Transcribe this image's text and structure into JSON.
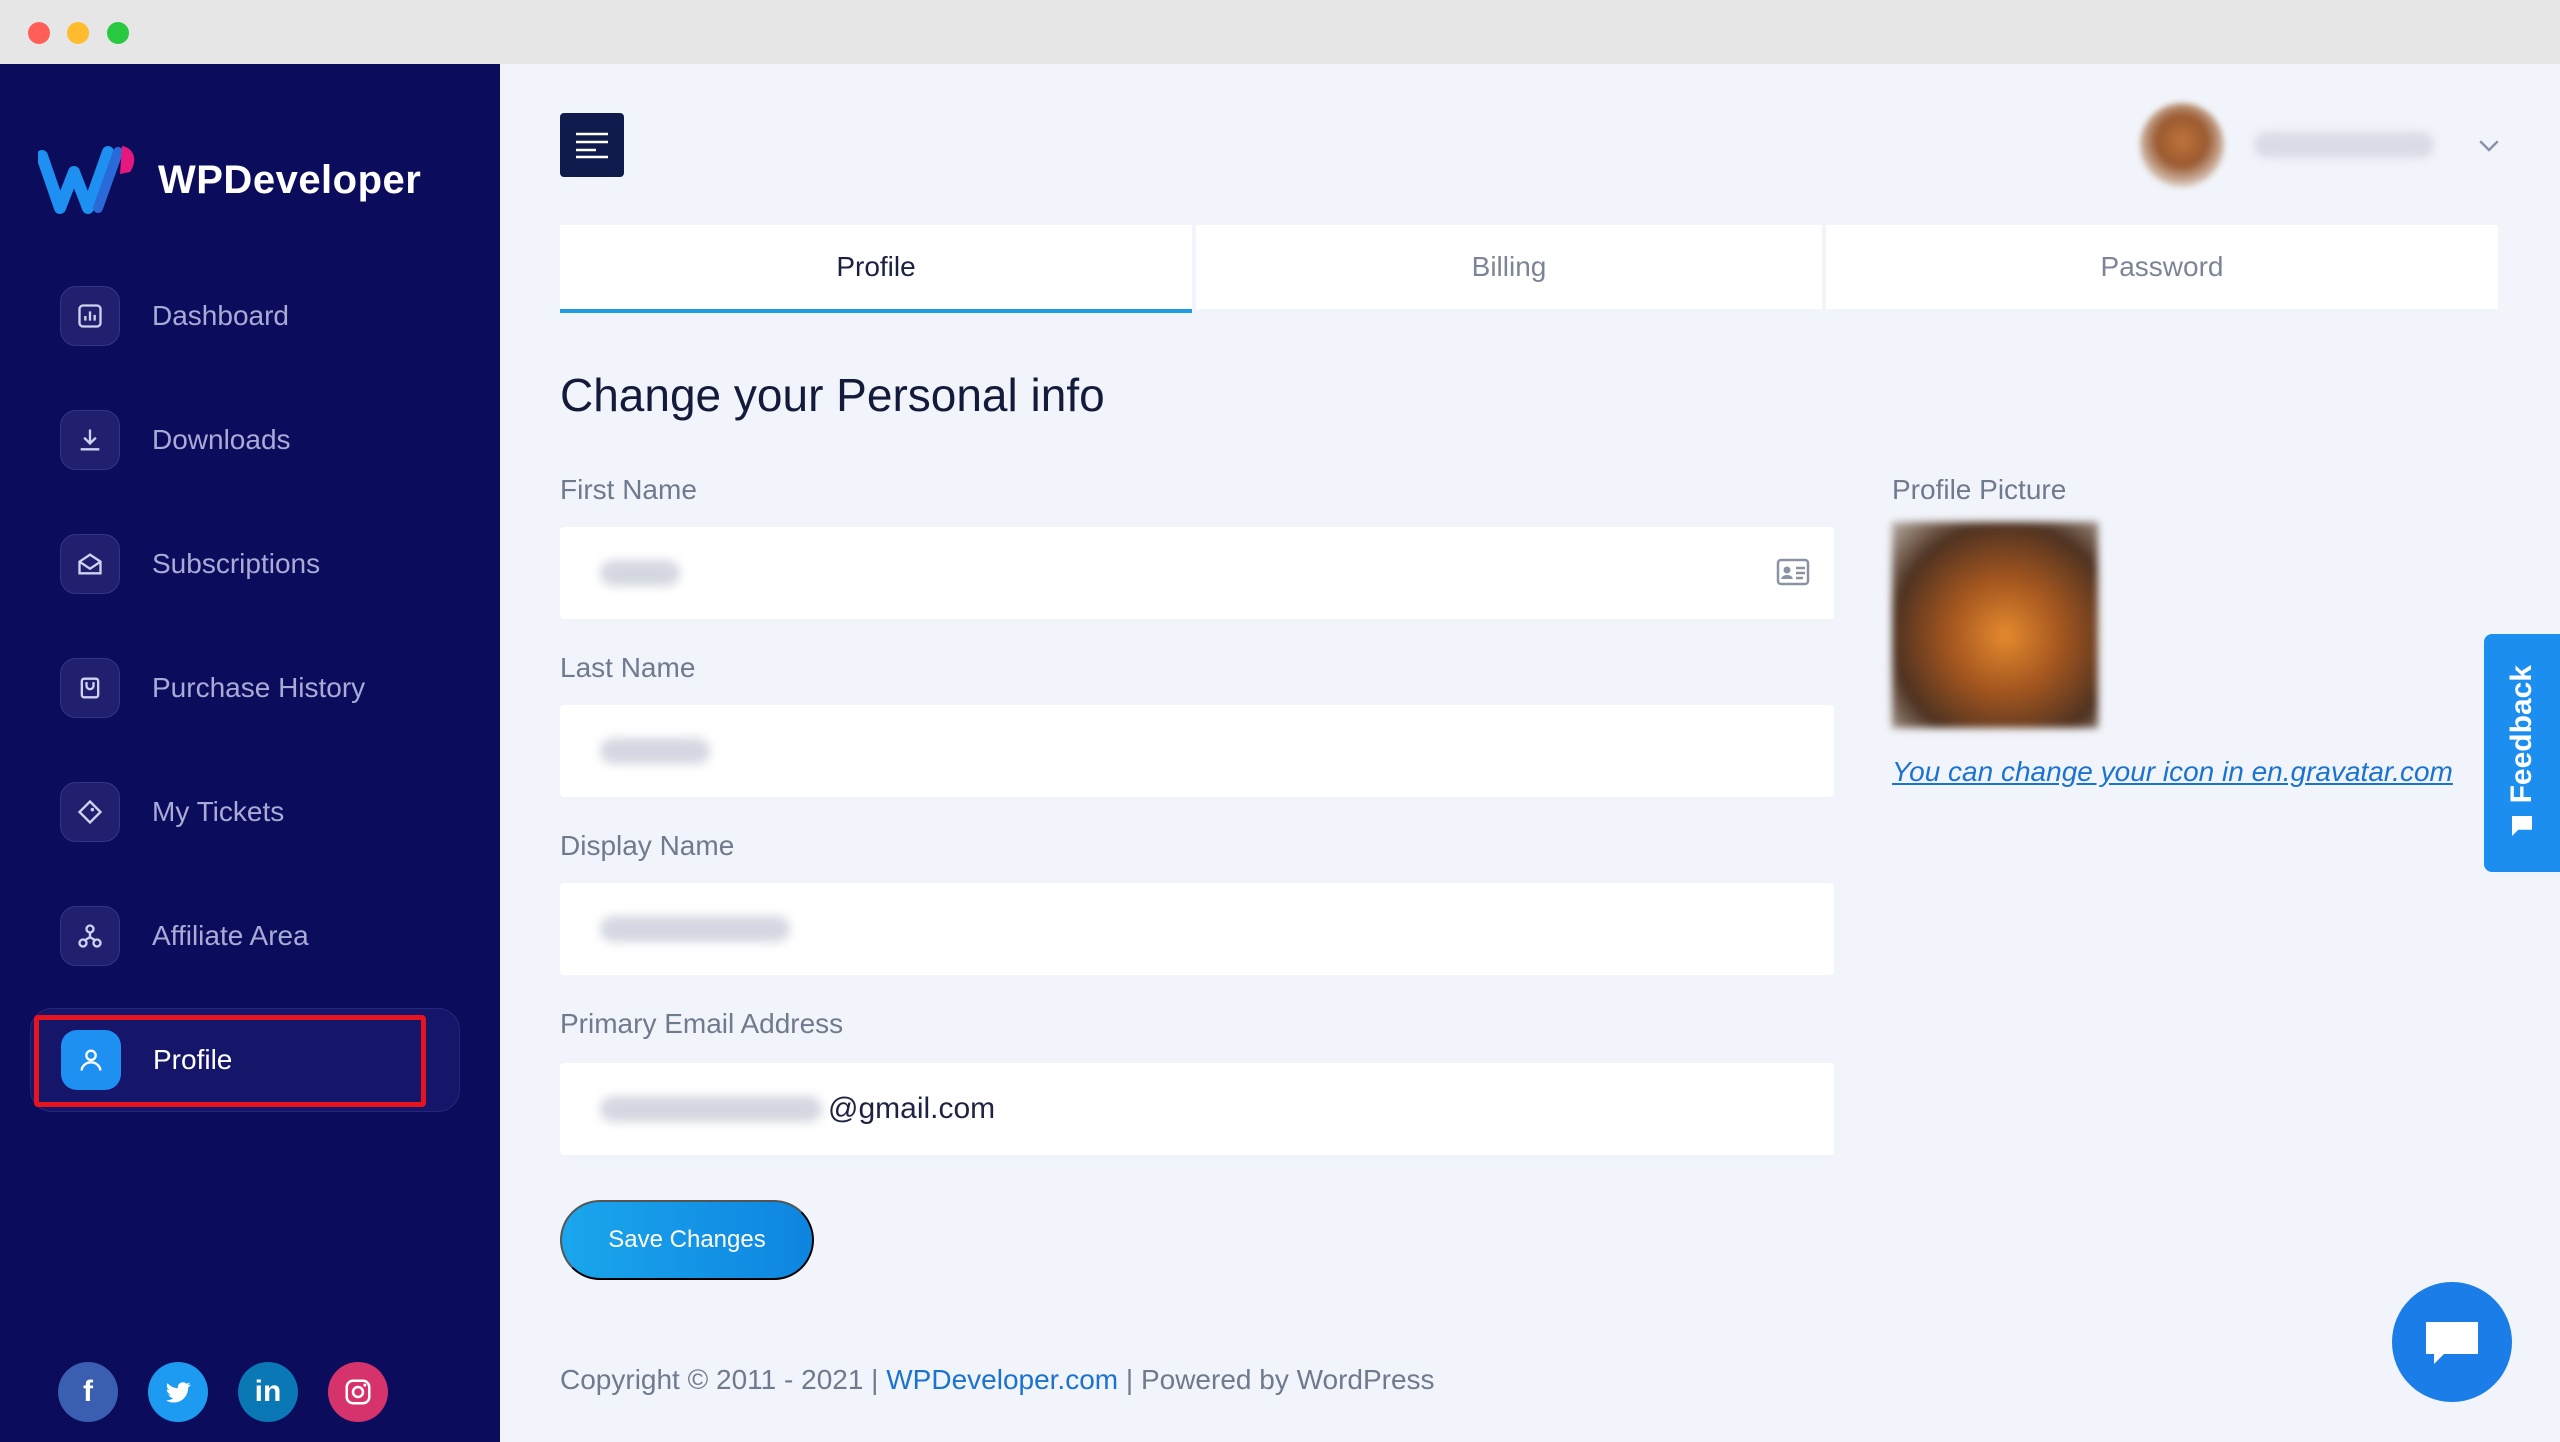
{
  "brand": {
    "name": "WPDeveloper"
  },
  "sidebar": {
    "items": [
      {
        "label": "Dashboard",
        "icon": "chart-icon"
      },
      {
        "label": "Downloads",
        "icon": "download-icon"
      },
      {
        "label": "Subscriptions",
        "icon": "envelope-icon"
      },
      {
        "label": "Purchase History",
        "icon": "bag-icon"
      },
      {
        "label": "My Tickets",
        "icon": "ticket-icon"
      },
      {
        "label": "Affiliate Area",
        "icon": "network-icon"
      },
      {
        "label": "Profile",
        "icon": "user-icon",
        "active": true
      }
    ],
    "socials": [
      "facebook-icon",
      "twitter-icon",
      "linkedin-icon",
      "instagram-icon"
    ]
  },
  "tabs": [
    "Profile",
    "Billing",
    "Password"
  ],
  "form": {
    "title": "Change your Personal info",
    "first_name_label": "First Name",
    "last_name_label": "Last Name",
    "display_name_label": "Display Name",
    "email_label": "Primary Email Address",
    "email_suffix": "@gmail.com",
    "save_label": "Save Changes"
  },
  "profile_picture": {
    "label": "Profile Picture",
    "link_text": "You can change your icon in en.gravatar.com"
  },
  "footer": {
    "prefix": "Copyright © 2011 - 2021 | ",
    "link": "WPDeveloper.com",
    "suffix": " | Powered by WordPress"
  },
  "feedback": {
    "label": "Feedback"
  },
  "colors": {
    "sidebar_bg": "#0c0c5c",
    "accent": "#1e9be3",
    "highlight": "#e5141e"
  }
}
